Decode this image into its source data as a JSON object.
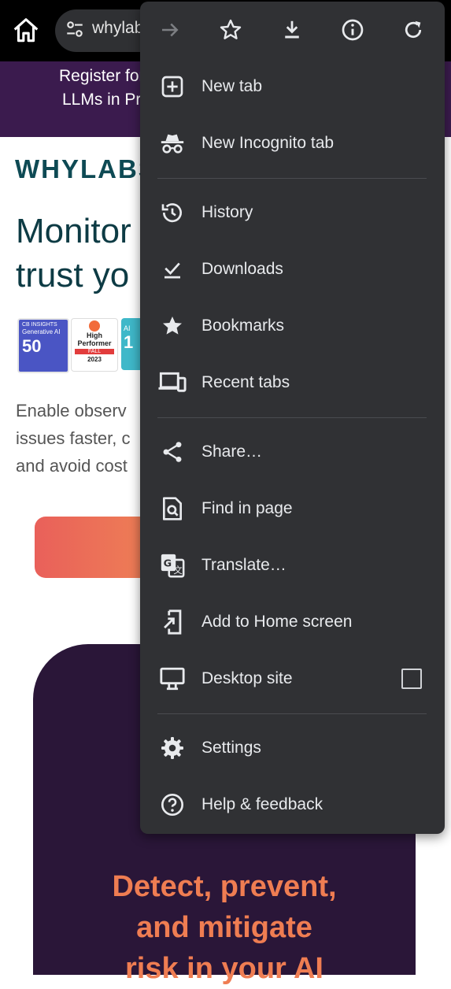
{
  "browser": {
    "url_text": "whylabs"
  },
  "banner": {
    "line1": "Register for",
    "line2": "LLMs in Pr"
  },
  "page": {
    "logo": "WHYLABS",
    "headline_line1": "Monitor",
    "headline_line2": "trust yo",
    "badges": [
      {
        "top": "Generative AI",
        "number": "50",
        "brand": "CB INSIGHTS"
      },
      {
        "top": "High Performer",
        "season": "FALL",
        "year": "2023"
      },
      {
        "top": "AI",
        "number": "1"
      }
    ],
    "para_line1": "Enable observ",
    "para_line2": "issues faster, c",
    "para_line3": "and avoid cost",
    "feature_line1": "Detect, prevent,",
    "feature_line2": "and mitigate",
    "feature_line3": "risk in your AI"
  },
  "menu": {
    "top_icons": [
      "forward-icon",
      "star-icon",
      "download-icon",
      "info-icon",
      "refresh-icon"
    ],
    "items": [
      {
        "label": "New tab",
        "icon": "new-tab-icon"
      },
      {
        "label": "New Incognito tab",
        "icon": "incognito-icon"
      },
      {
        "label": "History",
        "icon": "history-icon"
      },
      {
        "label": "Downloads",
        "icon": "downloads-icon"
      },
      {
        "label": "Bookmarks",
        "icon": "bookmarks-star-icon"
      },
      {
        "label": "Recent tabs",
        "icon": "devices-icon"
      },
      {
        "label": "Share…",
        "icon": "share-icon"
      },
      {
        "label": "Find in page",
        "icon": "find-in-page-icon"
      },
      {
        "label": "Translate…",
        "icon": "translate-icon"
      },
      {
        "label": "Add to Home screen",
        "icon": "add-to-home-icon"
      },
      {
        "label": "Desktop site",
        "icon": "desktop-icon",
        "checked": false
      },
      {
        "label": "Settings",
        "icon": "settings-gear-icon"
      },
      {
        "label": "Help & feedback",
        "icon": "help-icon"
      }
    ]
  },
  "colors": {
    "menu_bg": "#303134",
    "topbar_bg": "#000000",
    "banner_bg": "#3b1b4e",
    "accent_orange": "#ef7d52",
    "logo_teal": "#0e4a54"
  }
}
